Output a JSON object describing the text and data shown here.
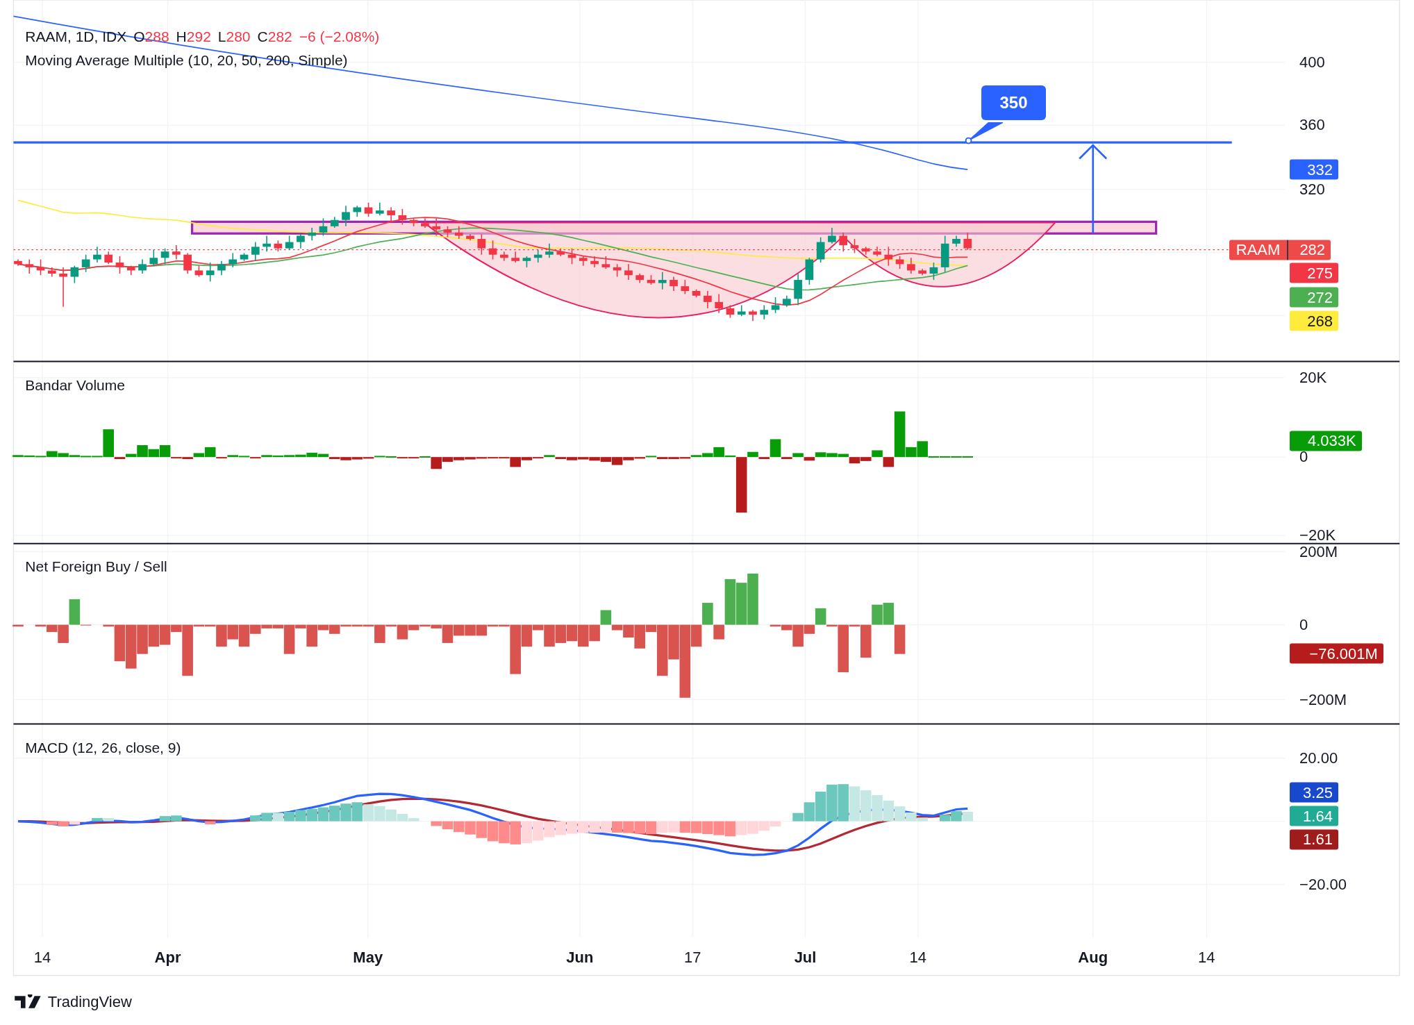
{
  "header": {
    "symbol": "RAAM, 1D, IDX",
    "ohlc": [
      {
        "label": "O",
        "value": "288"
      },
      {
        "label": "H",
        "value": "292"
      },
      {
        "label": "L",
        "value": "280"
      },
      {
        "label": "C",
        "value": "282"
      }
    ],
    "change": "−6 (−2.08%)"
  },
  "price_pane": {
    "legend": "Moving Average Multiple (10, 20, 50, 200, Simple)",
    "axis_labels": [
      "400",
      "360",
      "320"
    ],
    "target": "350",
    "symbol_tag": {
      "symbol": "RAAM",
      "price": "282",
      "color": "#ef4a4a"
    },
    "price_tags": [
      {
        "text": "332",
        "color": "#2962ff"
      },
      {
        "text": "275",
        "color": "#f23645"
      },
      {
        "text": "272",
        "color": "#4caf50"
      },
      {
        "text": "268",
        "color": "#ffeb3b"
      }
    ]
  },
  "volume_pane": {
    "title": "Bandar Volume",
    "axis_labels": [
      "20K",
      "0",
      "−20K"
    ],
    "tag": {
      "text": "4.033K",
      "color": "#089c08"
    }
  },
  "foreign_pane": {
    "title": "Net Foreign Buy / Sell",
    "axis_labels": [
      "200M",
      "0",
      "−200M"
    ],
    "tag": {
      "text": "−76.001M",
      "color": "#b71c1c"
    }
  },
  "macd_pane": {
    "title": "MACD (12, 26, close, 9)",
    "axis_labels": [
      "20.00",
      "−20.00"
    ],
    "tags": [
      {
        "text": "3.25",
        "color": "#1848cc"
      },
      {
        "text": "1.64",
        "color": "#22ab94"
      },
      {
        "text": "1.61",
        "color": "#9f1c1c"
      }
    ]
  },
  "time_axis": [
    {
      "label": "14",
      "kind": "day"
    },
    {
      "label": "Apr",
      "kind": "month"
    },
    {
      "label": "May",
      "kind": "month"
    },
    {
      "label": "Jun",
      "kind": "month"
    },
    {
      "label": "17",
      "kind": "day"
    },
    {
      "label": "Jul",
      "kind": "month"
    },
    {
      "label": "14",
      "kind": "day"
    },
    {
      "label": "Aug",
      "kind": "month"
    },
    {
      "label": "14",
      "kind": "day"
    }
  ],
  "brand": "TradingView"
}
